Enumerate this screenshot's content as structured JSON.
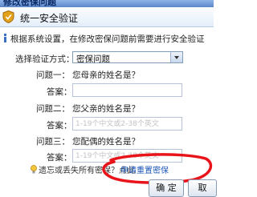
{
  "window": {
    "title": "修改密保问题"
  },
  "header": {
    "title": "统一安全验证"
  },
  "intro": {
    "text": "根据系统设置，在修改密保问题前需要进行安全验证"
  },
  "method": {
    "label": "选择验证方式：",
    "selected": "密保问题"
  },
  "questions": [
    {
      "q_label": "问题一：",
      "question": "您母亲的姓名是？",
      "a_label": "答案：",
      "placeholder": ""
    },
    {
      "q_label": "问题二：",
      "question": "您父亲的姓名是？",
      "a_label": "答案：",
      "placeholder": "1-19个中文或2-38个英文"
    },
    {
      "q_label": "问题三：",
      "question": "您配偶的姓名是？",
      "a_label": "答案：",
      "placeholder": "1-19个中文或2-38个英文"
    }
  ],
  "footer": {
    "text": "遗忘或丢失所有密保？点此",
    "link": "申请重置密保"
  },
  "buttons": {
    "confirm": "确 定",
    "cancel": "取"
  },
  "colors": {
    "accent": "#1a55b8",
    "annotation": "#e8141a"
  }
}
